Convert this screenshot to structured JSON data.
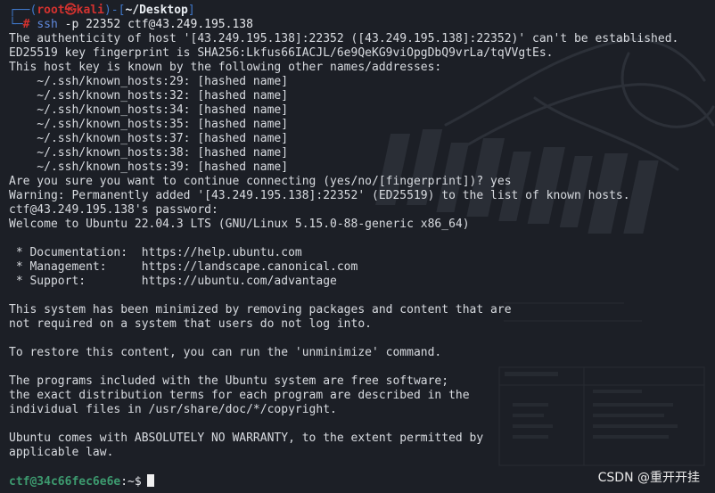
{
  "prompt": {
    "frame_top": "┌──(",
    "user": "root",
    "skull": "㉿",
    "host": "kali",
    "path_open": ")-[",
    "path": "~/Desktop",
    "path_close": "]",
    "frame_bottom": "└─",
    "hash": "#",
    "cmd_name": "ssh",
    "cmd_args": "-p 22352 ctf@43.249.195.138"
  },
  "output": {
    "auth_lines": [
      "The authenticity of host '[43.249.195.138]:22352 ([43.249.195.138]:22352)' can't be established.",
      "ED25519 key fingerprint is SHA256:Lkfus66IACJL/6e9QeKG9viOpgDbQ9vrLa/tqVVgtEs.",
      "This host key is known by the following other names/addresses:"
    ],
    "known_hosts": [
      "    ~/.ssh/known_hosts:29: [hashed name]",
      "    ~/.ssh/known_hosts:32: [hashed name]",
      "    ~/.ssh/known_hosts:34: [hashed name]",
      "    ~/.ssh/known_hosts:35: [hashed name]",
      "    ~/.ssh/known_hosts:37: [hashed name]",
      "    ~/.ssh/known_hosts:38: [hashed name]",
      "    ~/.ssh/known_hosts:39: [hashed name]"
    ],
    "confirm_lines": [
      "Are you sure you want to continue connecting (yes/no/[fingerprint])? yes",
      "Warning: Permanently added '[43.249.195.138]:22352' (ED25519) to the list of known hosts.",
      "ctf@43.249.195.138's password:",
      "Welcome to Ubuntu 22.04.3 LTS (GNU/Linux 5.15.0-88-generic x86_64)"
    ],
    "links": [
      " * Documentation:  https://help.ubuntu.com",
      " * Management:     https://landscape.canonical.com",
      " * Support:        https://ubuntu.com/advantage"
    ],
    "minimized": [
      "This system has been minimized by removing packages and content that are",
      "not required on a system that users do not log into."
    ],
    "restore": "To restore this content, you can run the 'unminimize' command.",
    "free_software": [
      "The programs included with the Ubuntu system are free software;",
      "the exact distribution terms for each program are described in the",
      "individual files in /usr/share/doc/*/copyright."
    ],
    "warranty": [
      "Ubuntu comes with ABSOLUTELY NO WARRANTY, to the extent permitted by",
      "applicable law."
    ]
  },
  "shell_prompt": {
    "user_host": "ctf@34c66fec6e6e",
    "path_sign": ":~$"
  },
  "watermark": "CSDN @重开开挂",
  "colors": {
    "background": "#1c1f26",
    "text": "#d8dbe0",
    "prompt_frame": "#3f77c9",
    "prompt_user": "#d4322f",
    "shell_user": "#3d9a6f"
  }
}
